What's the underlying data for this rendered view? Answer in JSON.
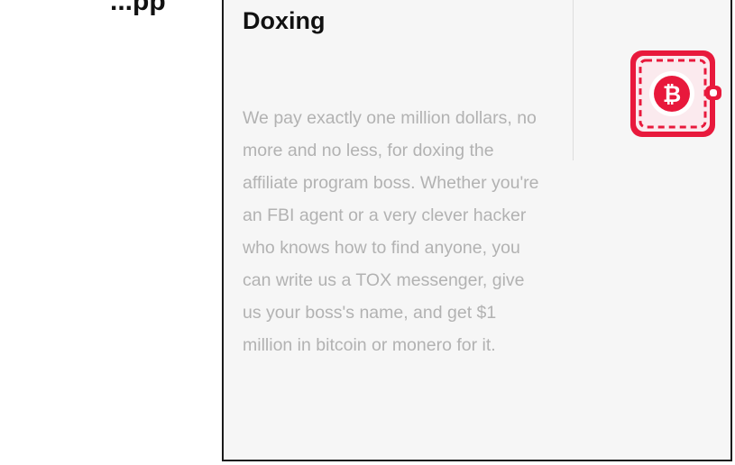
{
  "page": {
    "background_heading": "...pp"
  },
  "card": {
    "title": "Doxing",
    "body": "We pay exactly one million dollars, no more and no less, for doxing the affiliate program boss. Whether you're an FBI agent or a very clever hacker who knows how to find anyone, you can write us a TOX messenger, give us your boss's name, and get $1 million in bitcoin or monero for it.",
    "icon": "bitcoin-wallet-icon"
  },
  "colors": {
    "accent": "#e8193c",
    "panel_background": "#f6f6f6",
    "body_text": "#b2b2b2",
    "title_text": "#111111"
  }
}
